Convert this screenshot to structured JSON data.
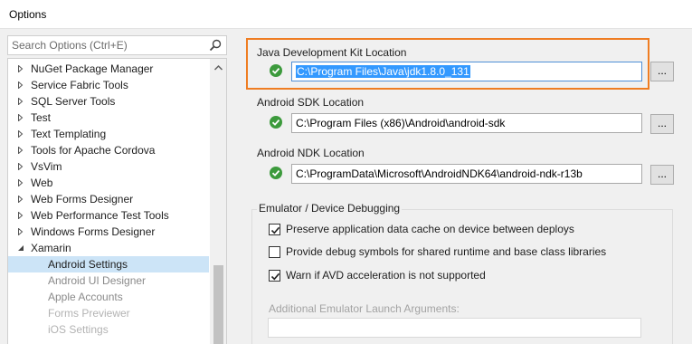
{
  "window": {
    "title": "Options"
  },
  "search": {
    "placeholder": "Search Options (Ctrl+E)"
  },
  "tree": {
    "items": [
      {
        "label": "NuGet Package Manager",
        "expanded": false
      },
      {
        "label": "Service Fabric Tools",
        "expanded": false
      },
      {
        "label": "SQL Server Tools",
        "expanded": false
      },
      {
        "label": "Test",
        "expanded": false
      },
      {
        "label": "Text Templating",
        "expanded": false
      },
      {
        "label": "Tools for Apache Cordova",
        "expanded": false
      },
      {
        "label": "VsVim",
        "expanded": false
      },
      {
        "label": "Web",
        "expanded": false
      },
      {
        "label": "Web Forms Designer",
        "expanded": false
      },
      {
        "label": "Web Performance Test Tools",
        "expanded": false
      },
      {
        "label": "Windows Forms Designer",
        "expanded": false
      },
      {
        "label": "Xamarin",
        "expanded": true
      }
    ],
    "children": [
      {
        "label": "Android Settings",
        "selected": true
      },
      {
        "label": "Android UI Designer"
      },
      {
        "label": "Apple Accounts"
      },
      {
        "label": "Forms Previewer"
      },
      {
        "label": "iOS Settings"
      }
    ]
  },
  "jdk": {
    "label": "Java Development Kit Location",
    "path": "C:\\Program Files\\Java\\jdk1.8.0_131",
    "browse": "...",
    "status_icon": "check-circle-icon"
  },
  "sdk": {
    "label": "Android SDK Location",
    "path": "C:\\Program Files (x86)\\Android\\android-sdk",
    "browse": "...",
    "status_icon": "check-circle-icon"
  },
  "ndk": {
    "label": "Android NDK Location",
    "path": "C:\\ProgramData\\Microsoft\\AndroidNDK64\\android-ndk-r13b",
    "browse": "...",
    "status_icon": "check-circle-icon"
  },
  "emulator": {
    "title": "Emulator / Device Debugging",
    "options": [
      {
        "label": "Preserve application data cache on device between deploys",
        "checked": true
      },
      {
        "label": "Provide debug symbols for shared runtime and base class libraries",
        "checked": false
      },
      {
        "label": "Warn if AVD acceleration is not supported",
        "checked": true
      }
    ],
    "args_label": "Additional Emulator Launch Arguments:",
    "args_value": ""
  },
  "colors": {
    "accent": "#ef7d22",
    "selection": "#3399ff",
    "ok_green": "#3c9a3c",
    "tree_selected": "#cce4f7"
  }
}
